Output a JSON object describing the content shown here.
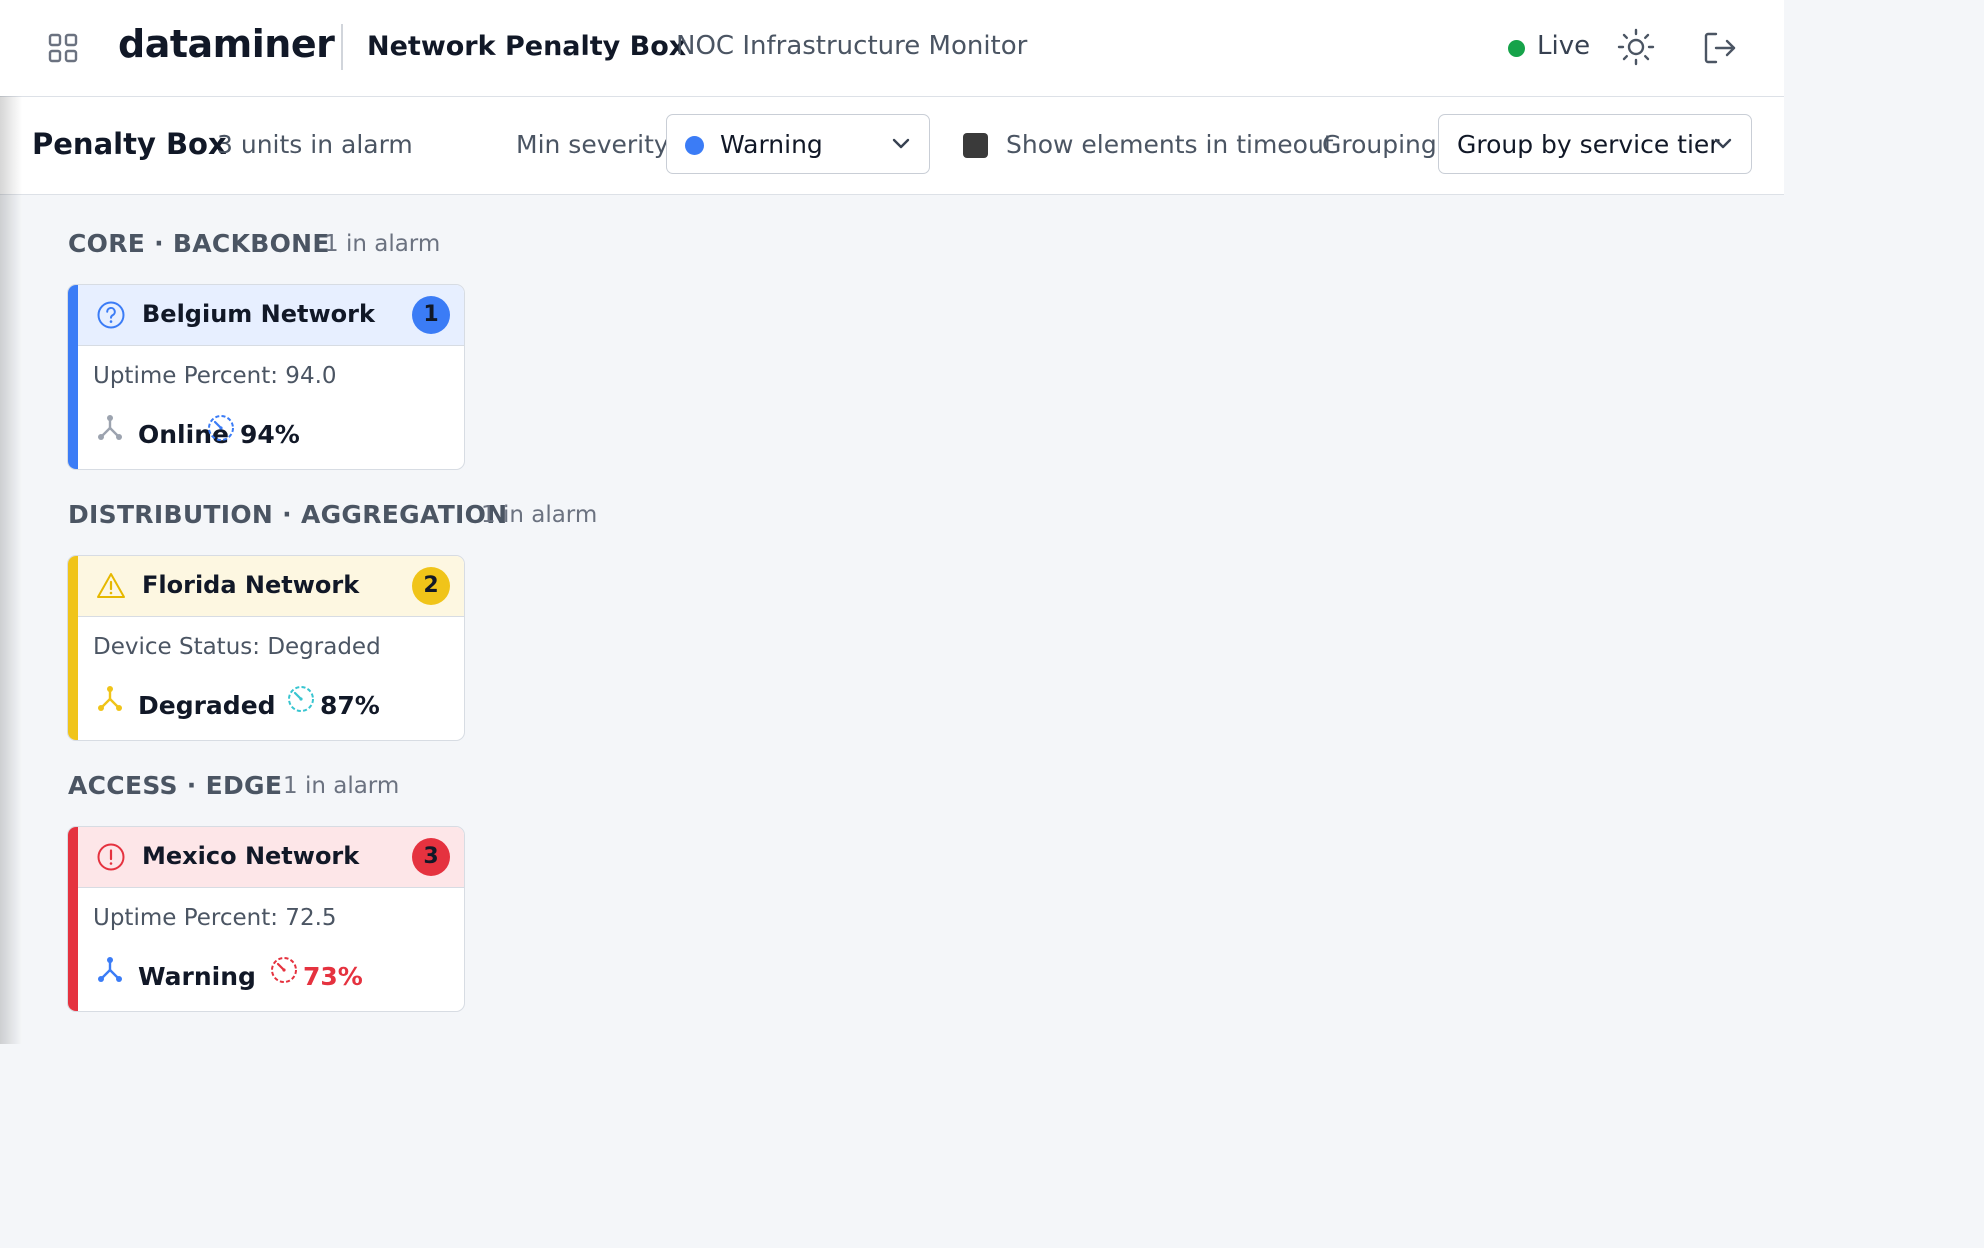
{
  "header": {
    "brand": "dataminer",
    "app_title": "Network Penalty Box",
    "app_subtitle": "NOC Infrastructure Monitor",
    "live_label": "Live"
  },
  "toolbar": {
    "title": "Penalty Box",
    "count": "3 units in alarm",
    "min_severity_label": "Min severity",
    "min_severity_value": "Warning",
    "timeout_label": "Show elements in timeout",
    "grouping_label": "Grouping",
    "grouping_value": "Group by service tier"
  },
  "colors": {
    "info": "#3b7cf6",
    "warning": "#f0c419",
    "critical": "#e5323f",
    "live": "#16a34a"
  },
  "groups": [
    {
      "title": "CORE · BACKBONE",
      "count": "1 in alarm",
      "card": {
        "name": "Belgium Network",
        "badge": "1",
        "head_icon": "question-circle-icon",
        "parameter": "Uptime Percent: 94.0",
        "state": "Online",
        "uptime": "94%"
      }
    },
    {
      "title": "DISTRIBUTION · AGGREGATION",
      "count": "1 in alarm",
      "card": {
        "name": "Florida Network",
        "badge": "2",
        "head_icon": "warning-triangle-icon",
        "parameter": "Device Status: Degraded",
        "state": "Degraded",
        "uptime": "87%"
      }
    },
    {
      "title": "ACCESS · EDGE",
      "count": "1 in alarm",
      "card": {
        "name": "Mexico Network",
        "badge": "3",
        "head_icon": "exclamation-circle-icon",
        "parameter": "Uptime Percent: 72.5",
        "state": "Warning",
        "uptime": "73%"
      }
    }
  ]
}
